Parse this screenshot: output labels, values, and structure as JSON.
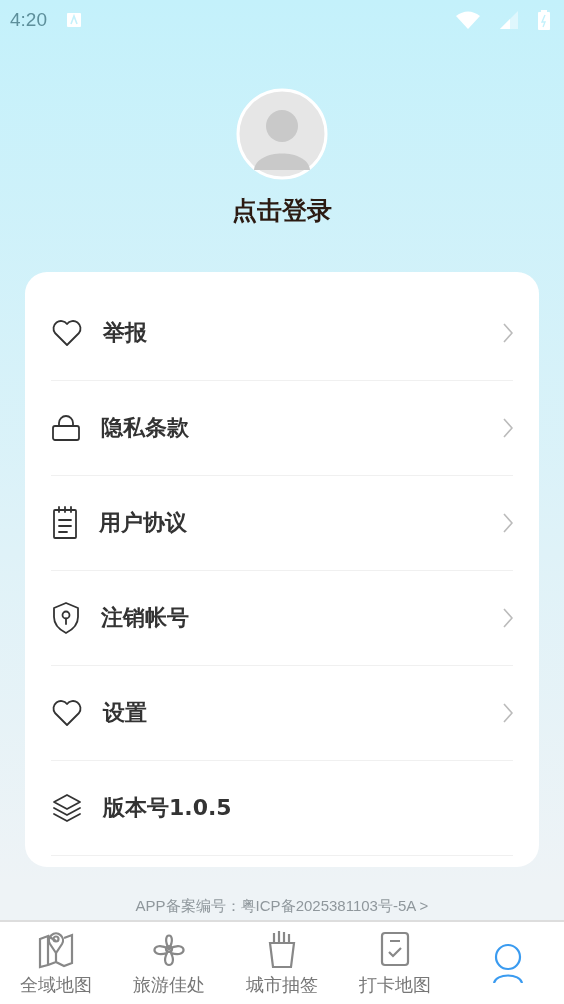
{
  "status_bar": {
    "time": "4:20"
  },
  "profile": {
    "login": "点击登录"
  },
  "menu": [
    {
      "label": "举报",
      "kind": "link"
    },
    {
      "label": "隐私条款",
      "kind": "link"
    },
    {
      "label": "用户协议",
      "kind": "link"
    },
    {
      "label": "注销帐号",
      "kind": "link"
    },
    {
      "label": "设置",
      "kind": "link"
    },
    {
      "label": "版本号1.0.5",
      "kind": "info"
    }
  ],
  "footer": {
    "record": "APP备案编号：粤ICP备2025381103号-5A >"
  },
  "tabs": [
    {
      "label": "全域地图",
      "selected": false
    },
    {
      "label": "旅游佳处",
      "selected": false
    },
    {
      "label": "城市抽签",
      "selected": false
    },
    {
      "label": "打卡地图",
      "selected": false
    },
    {
      "selected": true
    }
  ]
}
